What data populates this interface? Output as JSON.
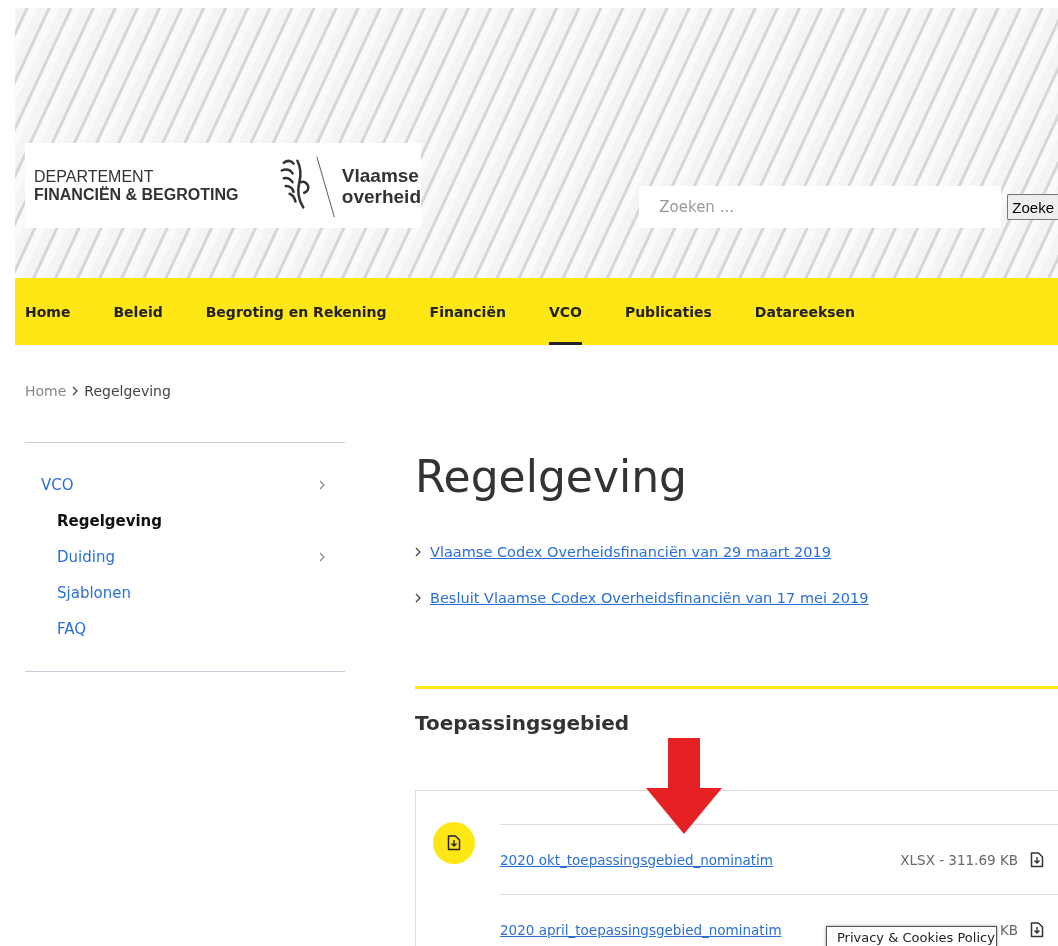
{
  "header": {
    "logo": {
      "department_line1": "DEPARTEMENT",
      "department_line2": "FINANCIËN & BEGROTING",
      "brand_line1": "Vlaamse",
      "brand_line2": "overheid"
    },
    "search": {
      "placeholder": "Zoeken ...",
      "button": "Zoeke"
    }
  },
  "nav": [
    {
      "label": "Home",
      "selected": false
    },
    {
      "label": "Beleid",
      "selected": false
    },
    {
      "label": "Begroting en Rekening",
      "selected": false
    },
    {
      "label": "Financiën",
      "selected": false
    },
    {
      "label": "VCO",
      "selected": true
    },
    {
      "label": "Publicaties",
      "selected": false
    },
    {
      "label": "Datareeksen",
      "selected": false
    }
  ],
  "breadcrumb": [
    {
      "label": "Home",
      "current": false
    },
    {
      "label": "Regelgeving",
      "current": true
    }
  ],
  "sidebar": {
    "items": [
      {
        "label": "VCO",
        "selected": false,
        "expandable": true,
        "children": [
          {
            "label": "Regelgeving",
            "selected": true,
            "expandable": false
          },
          {
            "label": "Duiding",
            "selected": false,
            "expandable": true
          },
          {
            "label": "Sjablonen",
            "selected": false,
            "expandable": false
          },
          {
            "label": "FAQ",
            "selected": false,
            "expandable": false
          }
        ]
      }
    ]
  },
  "content": {
    "title": "Regelgeving",
    "links": [
      "Vlaamse Codex Overheidsfinanciën van 29 maart 2019",
      "Besluit Vlaamse Codex Overheidsfinanciën van 17 mei 2019"
    ],
    "section": {
      "title": "Toepassingsgebied",
      "files": [
        {
          "name": "2020 okt_toepassingsgebied_nominatim",
          "meta": "XLSX - 311.69 KB"
        },
        {
          "name": "2020 april_toepassingsgebied_nominatim",
          "meta": "KB"
        }
      ]
    },
    "tooltip": "Privacy & Cookies Policy"
  }
}
